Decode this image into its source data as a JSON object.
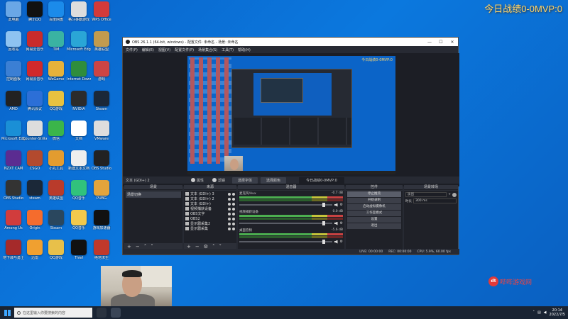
{
  "overlay": {
    "top_right_text": "今日战绩0-0MVP:0",
    "watermark_text": "哔哔游戏网",
    "watermark_logo": "dt"
  },
  "colors": {
    "desktop_bg": "#0b72d6",
    "obs_bg": "#272a33",
    "overlay_text": "#ffd66b",
    "meter_green": "#4caf50"
  },
  "desktop_icons": [
    {
      "label": "此电脑",
      "icon": "computer-icon",
      "color": "#6aa7e6"
    },
    {
      "label": "腾讯QQ",
      "icon": "qq-icon",
      "color": "#111"
    },
    {
      "label": "百度网盘",
      "icon": "netdisk-icon",
      "color": "#1b8bea"
    },
    {
      "label": "格斗争霸游戏",
      "icon": "game-icon",
      "color": "#ddd"
    },
    {
      "label": "WPS Office",
      "icon": "wps-icon",
      "color": "#d23a3a"
    },
    {
      "label": "回收站",
      "icon": "recycle-bin-icon",
      "color": "#8ec3f1"
    },
    {
      "label": "网易云音乐",
      "icon": "music-icon",
      "color": "#c92b2b"
    },
    {
      "label": "TIM",
      "icon": "tim-icon",
      "color": "#3ab3a2"
    },
    {
      "label": "Microsoft Edge",
      "icon": "edge-icon",
      "color": "#2aa6d6"
    },
    {
      "label": "英雄联盟",
      "icon": "lol-icon",
      "color": "#c29b4e"
    },
    {
      "label": "控制面板",
      "icon": "control-panel-icon",
      "color": "#3b7fd4"
    },
    {
      "label": "网易云音乐",
      "icon": "music-icon",
      "color": "#d0292c"
    },
    {
      "label": "WeGame",
      "icon": "wegame-icon",
      "color": "#e6b23a"
    },
    {
      "label": "Internet Download",
      "icon": "idm-icon",
      "color": "#2f8d3c"
    },
    {
      "label": "游戏",
      "icon": "game-icon",
      "color": "#c44"
    },
    {
      "label": "AMD",
      "icon": "amd-icon",
      "color": "#222"
    },
    {
      "label": "腾讯会议",
      "icon": "meeting-icon",
      "color": "#2c6fd7"
    },
    {
      "label": "QQ游戏",
      "icon": "qqgame-icon",
      "color": "#e9c23f"
    },
    {
      "label": "NVIDIA",
      "icon": "nvidia-icon",
      "color": "#2b2b2b"
    },
    {
      "label": "Steam",
      "icon": "steam-icon",
      "color": "#1b2838"
    },
    {
      "label": "Microsoft Edge",
      "icon": "edge-icon",
      "color": "#1a8fd6"
    },
    {
      "label": "Counter-Strike",
      "icon": "cs-icon",
      "color": "#ddd"
    },
    {
      "label": "微信",
      "icon": "wechat-icon",
      "color": "#3bb54a"
    },
    {
      "label": "文档",
      "icon": "doc-icon",
      "color": "#fff"
    },
    {
      "label": "VMware",
      "icon": "vmware-icon",
      "color": "#ddd"
    },
    {
      "label": "NZXT CAM",
      "icon": "nzxt-icon",
      "color": "#5b2c91"
    },
    {
      "label": "CSGO",
      "icon": "csgo-icon",
      "color": "#b34a2e"
    },
    {
      "label": "小丸工具",
      "icon": "tool-icon",
      "color": "#e39c2f"
    },
    {
      "label": "新建文本文档",
      "icon": "txt-icon",
      "color": "#eee"
    },
    {
      "label": "OBS Studio",
      "icon": "obs-icon",
      "color": "#222"
    },
    {
      "label": "OBS Studio",
      "icon": "obs-icon",
      "color": "#333"
    },
    {
      "label": "steam",
      "icon": "steam-icon",
      "color": "#1b2838"
    },
    {
      "label": "英雄联盟",
      "icon": "lol-icon",
      "color": "#b93b2b"
    },
    {
      "label": "QQ音乐",
      "icon": "qqmusic-icon",
      "color": "#31c27c"
    },
    {
      "label": "PUBG",
      "icon": "pubg-icon",
      "color": "#e3a43b"
    },
    {
      "label": "Among Us",
      "icon": "amongus-icon",
      "color": "#d13c3c"
    },
    {
      "label": "Origin",
      "icon": "origin-icon",
      "color": "#f56c2d"
    },
    {
      "label": "Steam",
      "icon": "steam-icon",
      "color": "#2a475e"
    },
    {
      "label": "QQ音乐",
      "icon": "qqmusic-icon",
      "color": "#f2c94c"
    },
    {
      "label": "游戏加速器",
      "icon": "booster-icon",
      "color": "#111"
    },
    {
      "label": "地下城与勇士",
      "icon": "dnf-icon",
      "color": "#a52a2a"
    },
    {
      "label": "迅雷",
      "icon": "thunder-icon",
      "color": "#f0a030"
    },
    {
      "label": "QQ游戏",
      "icon": "qqgame-icon",
      "color": "#e8c04a"
    },
    {
      "label": "Thief",
      "icon": "game-icon",
      "color": "#111"
    },
    {
      "label": "绝地求生",
      "icon": "game-icon",
      "color": "#c0392b"
    }
  ],
  "obs": {
    "window_title": "OBS 26.1.1 (64-bit, windows) - 配置文件: 未命名 - 场景: 未命名",
    "menu": [
      "文件(F)",
      "编辑(E)",
      "视图(V)",
      "配置文件(P)",
      "场景集合(S)",
      "工具(T)",
      "帮助(H)"
    ],
    "scene_bar": {
      "current": "文本 (GDI+) 2",
      "properties": "属性",
      "filters": "滤镜",
      "tab1": "选择字体",
      "tab2": "选择颜色",
      "text_preview": "今日战绩0-0MVP:0"
    },
    "preview_overlay": "今日战绩0-0MVP:0",
    "docks": {
      "scenes": {
        "title": "场景",
        "items": [
          "场景切换"
        ]
      },
      "sources": {
        "title": "来源",
        "items": [
          "文本 (GDI+) 3",
          "文本 (GDI+) 2",
          "文本 (GDI+)",
          "视频捕获设备",
          "OBS文字",
          "OBS2",
          "显示器采集2",
          "显示器采集"
        ]
      },
      "mixer": {
        "title": "混音器",
        "tracks": [
          {
            "name": "麦克风/Aux",
            "db": "-0.7 dB"
          },
          {
            "name": "视频捕获设备",
            "db": "0.0 dB"
          },
          {
            "name": "桌面音频",
            "db": "-5.6 dB"
          }
        ]
      },
      "controls": {
        "title": "控件",
        "buttons": [
          "停止推流",
          "开始录制",
          "启动虚拟摄像机",
          "工作室模式",
          "设置",
          "退出"
        ]
      },
      "transitions": {
        "title": "场景转场",
        "type": "淡出",
        "duration_label": "时长",
        "duration": "300 ms"
      }
    },
    "status": {
      "live": "LIVE: 00:00:00",
      "rec": "REC: 00:00:00",
      "cpu": "CPU: 5.9%, 60.00 fps"
    }
  },
  "taskbar": {
    "search_placeholder": "在这里输入你要搜索的内容",
    "time": "20:14",
    "date": "2022/7/5"
  }
}
